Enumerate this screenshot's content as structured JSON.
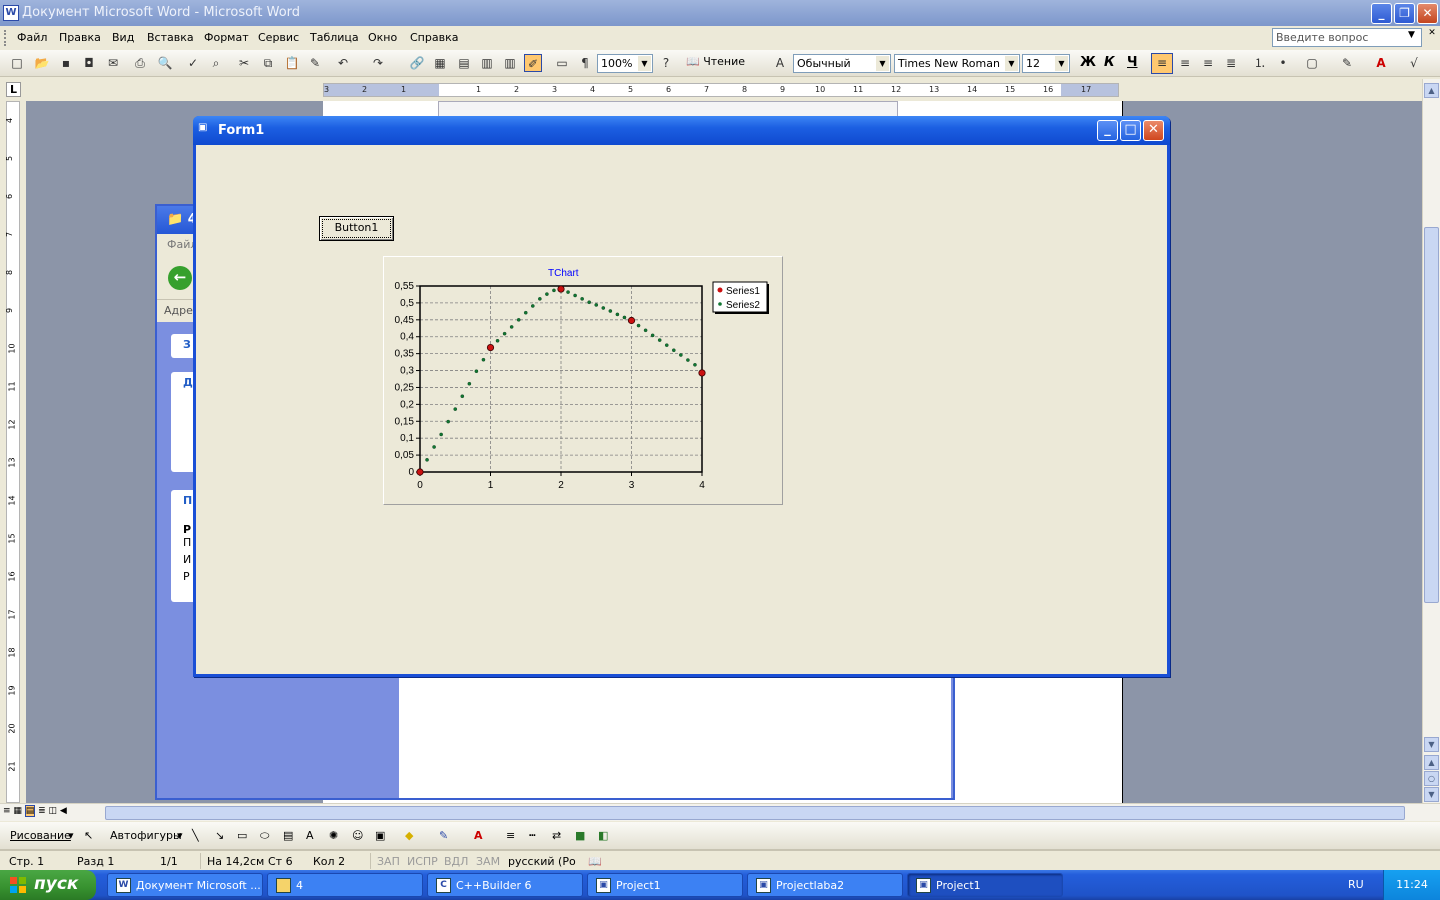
{
  "word": {
    "title": "Документ Microsoft Word - Microsoft Word",
    "menu": [
      "Файл",
      "Правка",
      "Вид",
      "Вставка",
      "Формат",
      "Сервис",
      "Таблица",
      "Окно",
      "Справка"
    ],
    "ask_placeholder": "Введите вопрос",
    "zoom": "100%",
    "read_label": "Чтение",
    "style": "Обычный",
    "font": "Times New Roman",
    "font_size": "12",
    "bold": "Ж",
    "italic": "К",
    "underline": "Ч"
  },
  "ruler_h": [
    "3",
    "2",
    "1",
    "1",
    "2",
    "3",
    "4",
    "5",
    "6",
    "7",
    "8",
    "9",
    "10",
    "11",
    "12",
    "13",
    "14",
    "15",
    "16",
    "17"
  ],
  "ruler_v": [
    "4",
    "5",
    "6",
    "7",
    "8",
    "9",
    "10",
    "11",
    "12",
    "13",
    "14",
    "15",
    "16",
    "17",
    "18",
    "19",
    "20",
    "21"
  ],
  "drawing": {
    "draw_label": "Рисование",
    "autoshapes_label": "Автофигуры"
  },
  "status": {
    "page": "Стр. 1",
    "section": "Разд 1",
    "pages": "1/1",
    "at": "На 14,2см",
    "line": "Ст 6",
    "col": "Кол 2",
    "rec": "ЗАП",
    "trk": "ИСПР",
    "ext": "ВДЛ",
    "ovr": "ЗАМ",
    "lang": "русский (Ро"
  },
  "explorer": {
    "title": "4",
    "menu_stub": "Файл",
    "addr_stub": "Адрес",
    "panel_letters": [
      "З",
      "Д",
      "П"
    ],
    "side_letters": [
      "Р",
      "П",
      "И",
      "Р"
    ]
  },
  "form1": {
    "title": "Form1",
    "button_label": "Button1"
  },
  "chart_data": {
    "type": "line",
    "title": "TChart",
    "xlim": [
      0,
      4
    ],
    "ylim": [
      0,
      0.55
    ],
    "x_ticks": [
      "0",
      "1",
      "2",
      "3",
      "4"
    ],
    "y_ticks": [
      "0",
      "0,05",
      "0,1",
      "0,15",
      "0,2",
      "0,25",
      "0,3",
      "0,35",
      "0,4",
      "0,45",
      "0,5",
      "0,55"
    ],
    "grid": true,
    "legend_position": "right",
    "series": [
      {
        "name": "Series1",
        "color": "#cc1111",
        "marker": "circle",
        "line": false,
        "x": [
          0,
          1,
          2,
          3,
          4
        ],
        "y": [
          0,
          0.368,
          0.541,
          0.448,
          0.293
        ]
      },
      {
        "name": "Series2",
        "color": "#117733",
        "marker": "small-dot",
        "line": false,
        "x": [
          0,
          0.1,
          0.2,
          0.3,
          0.4,
          0.5,
          0.6,
          0.7,
          0.8,
          0.9,
          1.0,
          1.1,
          1.2,
          1.3,
          1.4,
          1.5,
          1.6,
          1.7,
          1.8,
          1.9,
          2.0,
          2.1,
          2.2,
          2.3,
          2.4,
          2.5,
          2.6,
          2.7,
          2.8,
          2.9,
          3.0,
          3.1,
          3.2,
          3.3,
          3.4,
          3.5,
          3.6,
          3.7,
          3.8,
          3.9,
          4.0
        ],
        "y": [
          0,
          0.036,
          0.074,
          0.111,
          0.149,
          0.186,
          0.224,
          0.261,
          0.298,
          0.332,
          0.368,
          0.388,
          0.409,
          0.429,
          0.45,
          0.471,
          0.491,
          0.512,
          0.526,
          0.537,
          0.541,
          0.532,
          0.522,
          0.512,
          0.502,
          0.494,
          0.485,
          0.476,
          0.466,
          0.457,
          0.448,
          0.433,
          0.419,
          0.404,
          0.39,
          0.375,
          0.36,
          0.346,
          0.331,
          0.317,
          0.293
        ]
      }
    ]
  },
  "taskbar": {
    "start_label": "пуск",
    "tasks": [
      "Документ Microsoft ...",
      "4",
      "C++Builder 6",
      "Project1",
      "Projectlaba2",
      "Project1"
    ],
    "lang": "RU",
    "clock": "11:24"
  }
}
